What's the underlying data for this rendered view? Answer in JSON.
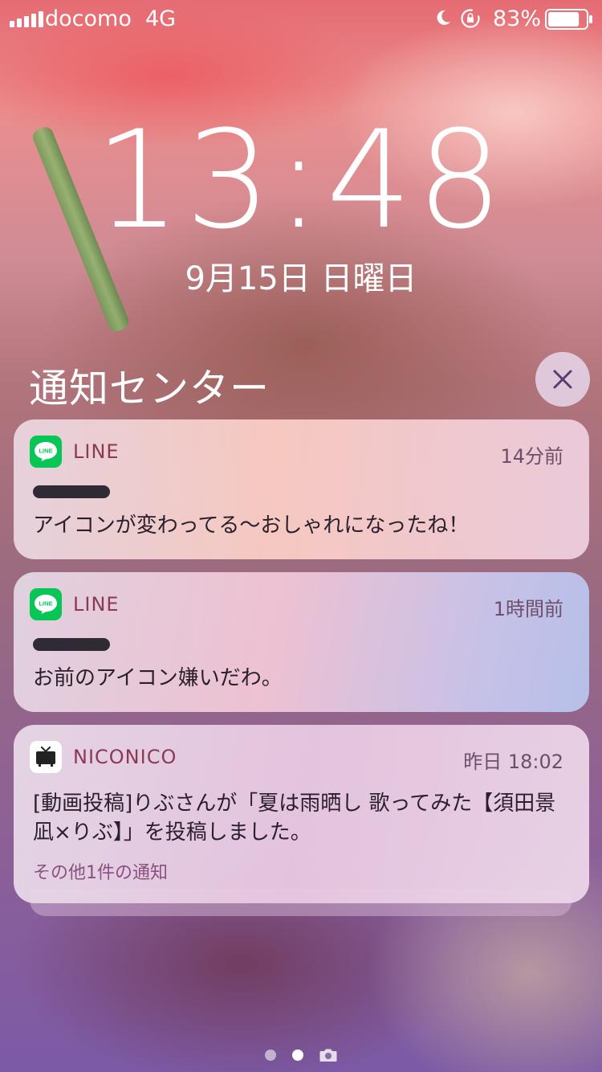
{
  "status_bar": {
    "carrier": "docomo",
    "network": "4G",
    "battery_percent": "83%",
    "battery_level": 0.83,
    "signal_bars": 5,
    "icons": [
      "moon-icon",
      "lock-rotation-icon",
      "battery-icon"
    ]
  },
  "lock_screen": {
    "time": "13:48",
    "date": "9月15日 日曜日"
  },
  "notification_center": {
    "title": "通知センター",
    "clear_icon": "close-icon",
    "notifications": [
      {
        "app": "LINE",
        "icon": "line-icon",
        "time": "14分前",
        "body": "アイコンが変わってる〜おしゃれになったね！"
      },
      {
        "app": "LINE",
        "icon": "line-icon",
        "time": "1時間前",
        "body": "お前のアイコン嫌いだわ。"
      },
      {
        "app": "NICONICO",
        "icon": "tv-icon",
        "time": "昨日 18:02",
        "body": "[動画投稿]りぶさんが「夏は雨晒し 歌ってみた【須田景凪×りぶ】」を投稿しました。",
        "more": "その他1件の通知"
      }
    ]
  },
  "page_indicator": {
    "pages": 2,
    "active_page": 2,
    "camera_icon": "camera-icon"
  },
  "icon_labels": {
    "line": "LINE"
  },
  "colors": {
    "line_green": "#06c755",
    "app_name": "#8a3a55"
  }
}
